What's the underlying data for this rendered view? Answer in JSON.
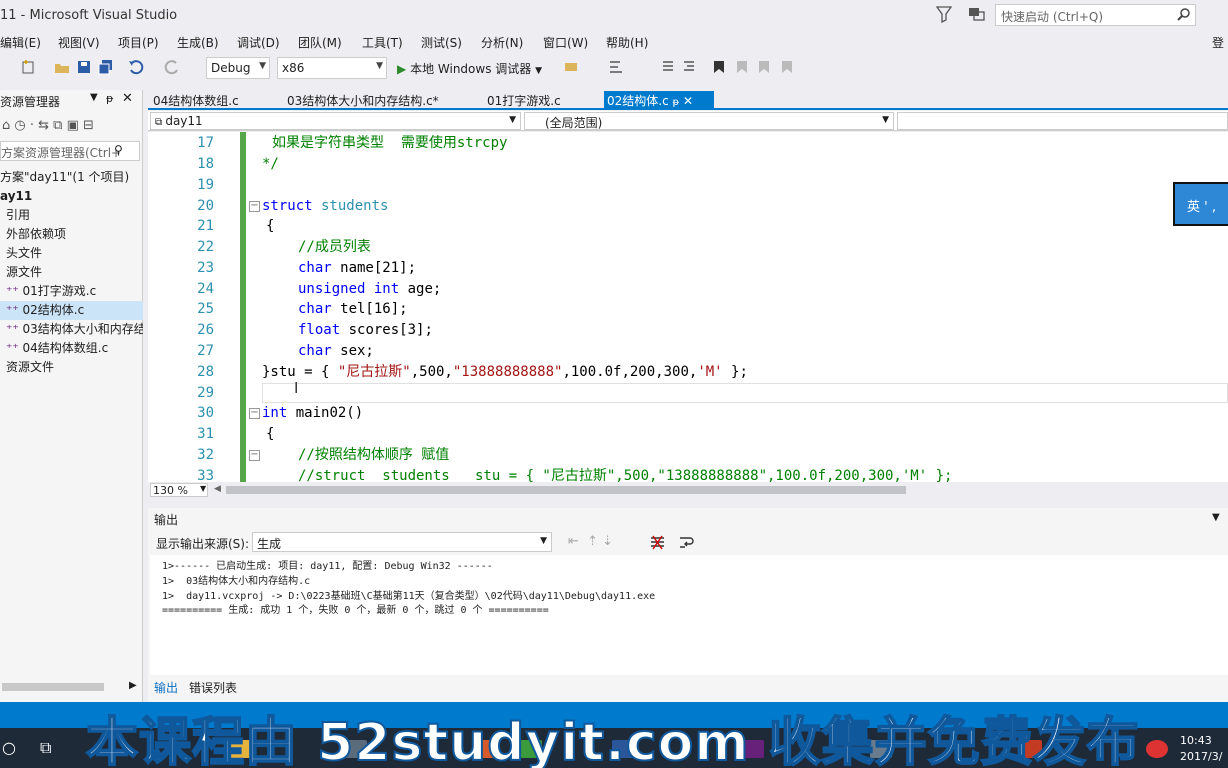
{
  "window": {
    "title": "11 - Microsoft Visual Studio"
  },
  "quick_launch": {
    "placeholder": "快速启动 (Ctrl+Q)"
  },
  "signin": "登",
  "menu": [
    "编辑(E)",
    "视图(V)",
    "项目(P)",
    "生成(B)",
    "调试(D)",
    "团队(M)",
    "工具(T)",
    "测试(S)",
    "分析(N)",
    "窗口(W)",
    "帮助(H)"
  ],
  "toolbar": {
    "config": "Debug",
    "platform": "x86",
    "run": "本地 Windows 调试器"
  },
  "solution_explorer": {
    "title": "资源管理器",
    "search_placeholder": "方案资源管理器(Ctrl+",
    "items": [
      {
        "label": "方案\"day11\"(1 个项目)"
      },
      {
        "label": "ay11"
      },
      {
        "label": "引用"
      },
      {
        "label": "外部依赖项"
      },
      {
        "label": "头文件"
      },
      {
        "label": "源文件"
      },
      {
        "label": "01打字游戏.c"
      },
      {
        "label": "02结构体.c"
      },
      {
        "label": "03结构体大小和内存结"
      },
      {
        "label": "04结构体数组.c"
      },
      {
        "label": "资源文件"
      }
    ]
  },
  "tabs": [
    {
      "label": "04结构体数组.c"
    },
    {
      "label": "03结构体大小和内存结构.c*"
    },
    {
      "label": "01打字游戏.c"
    },
    {
      "label": "02结构体.c"
    }
  ],
  "navbar": {
    "project": "day11",
    "scope": "(全局范围)"
  },
  "editor": {
    "line_numbers": [
      "17",
      "18",
      "19",
      "20",
      "21",
      "22",
      "23",
      "24",
      "25",
      "26",
      "27",
      "28",
      "29",
      "30",
      "31",
      "32",
      "33"
    ],
    "lines": {
      "l17": "如果是字符串类型  需要使用strcpy",
      "l18": "*/",
      "l20a": "struct",
      "l20b": " students",
      "l21": "{",
      "l22": "//成员列表",
      "l23a": "char",
      "l23b": " name[21];",
      "l24a": "unsigned int",
      "l24b": " age;",
      "l25a": "char",
      "l25b": " tel[16];",
      "l26a": "float",
      "l26b": " scores[3];",
      "l27a": "char",
      "l27b": " sex;",
      "l28a": "}stu = { ",
      "l28b": "\"尼古拉斯\"",
      "l28c": ",500,",
      "l28d": "\"13888888888\"",
      "l28e": ",100.0f,200,300,",
      "l28f": "'M'",
      "l28g": " };",
      "l30a": "int",
      "l30b": " main02()",
      "l31": "{",
      "l32": "//按照结构体顺序 赋值",
      "l33": "//struct  students   stu = { \"尼古拉斯\",500,\"13888888888\",100.0f,200,300,'M' };"
    },
    "zoom": "130 %",
    "ime": "英 ' ,"
  },
  "output": {
    "title": "输出",
    "source_label": "显示输出来源(S):",
    "source": "生成",
    "lines": [
      "1>------ 已启动生成: 项目: day11, 配置: Debug Win32 ------",
      "1>  03结构体大小和内存结构.c",
      "1>  day11.vcxproj -> D:\\0223基础班\\C基础第11天（复合类型）\\02代码\\day11\\Debug\\day11.exe",
      "========== 生成: 成功 1 个，失败 0 个，最新 0 个，跳过 0 个 =========="
    ],
    "tabs": [
      "输出",
      "错误列表"
    ]
  },
  "watermark": "本课程由 52studyit.com 收集并免费发布",
  "clock": {
    "time": "10:43",
    "date": "2017/3/"
  },
  "colors": {
    "accent": "#007acc",
    "keyword": "#0000ff",
    "comment": "#008000",
    "string": "#a31515"
  }
}
